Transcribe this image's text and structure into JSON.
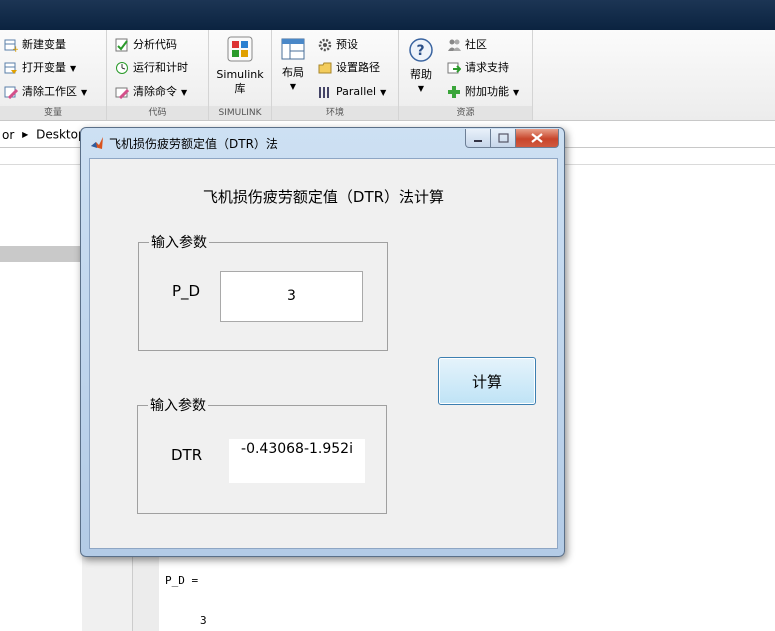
{
  "ribbon": {
    "groups": {
      "variable": {
        "label": "变量",
        "items": [
          {
            "label": "新建变量",
            "icon": "new-variable-icon"
          },
          {
            "label": "打开变量",
            "icon": "open-variable-icon"
          },
          {
            "label": "清除工作区",
            "icon": "clear-workspace-icon"
          }
        ]
      },
      "code": {
        "label": "代码",
        "items": [
          {
            "label": "分析代码",
            "icon": "analyze-code-icon"
          },
          {
            "label": "运行和计时",
            "icon": "run-and-time-icon"
          },
          {
            "label": "清除命令",
            "icon": "clear-commands-icon"
          }
        ]
      },
      "simulink": {
        "label": "SIMULINK",
        "button_line1": "Simulink",
        "button_line2": "库"
      },
      "environment": {
        "label": "环境",
        "layout_label": "布局",
        "items": [
          {
            "label": "预设",
            "icon": "gear-icon"
          },
          {
            "label": "设置路径",
            "icon": "folder-path-icon"
          },
          {
            "label": "Parallel",
            "icon": "parallel-icon"
          }
        ]
      },
      "resources": {
        "label": "资源",
        "help_label": "帮助",
        "items": [
          {
            "label": "社区",
            "icon": "community-icon"
          },
          {
            "label": "请求支持",
            "icon": "request-support-icon"
          },
          {
            "label": "附加功能",
            "icon": "add-ons-icon"
          }
        ]
      }
    }
  },
  "address": {
    "left": "or",
    "folder": "Desktop"
  },
  "dialog": {
    "title": "飞机损伤疲劳额定值（DTR）法",
    "heading": "飞机损伤疲劳额定值（DTR）法计算",
    "input_panel": {
      "legend": "输入参数",
      "label": "P_D",
      "value": "3"
    },
    "output_panel": {
      "legend": "输入参数",
      "label": "DTR",
      "value": "-0.43068-1.952i"
    },
    "calc_button": "计算"
  },
  "command_window": {
    "line1": "P_D =",
    "line2": "3"
  },
  "colors": {
    "accent": "#3c7fb1",
    "titlebar": "#0b2340"
  }
}
